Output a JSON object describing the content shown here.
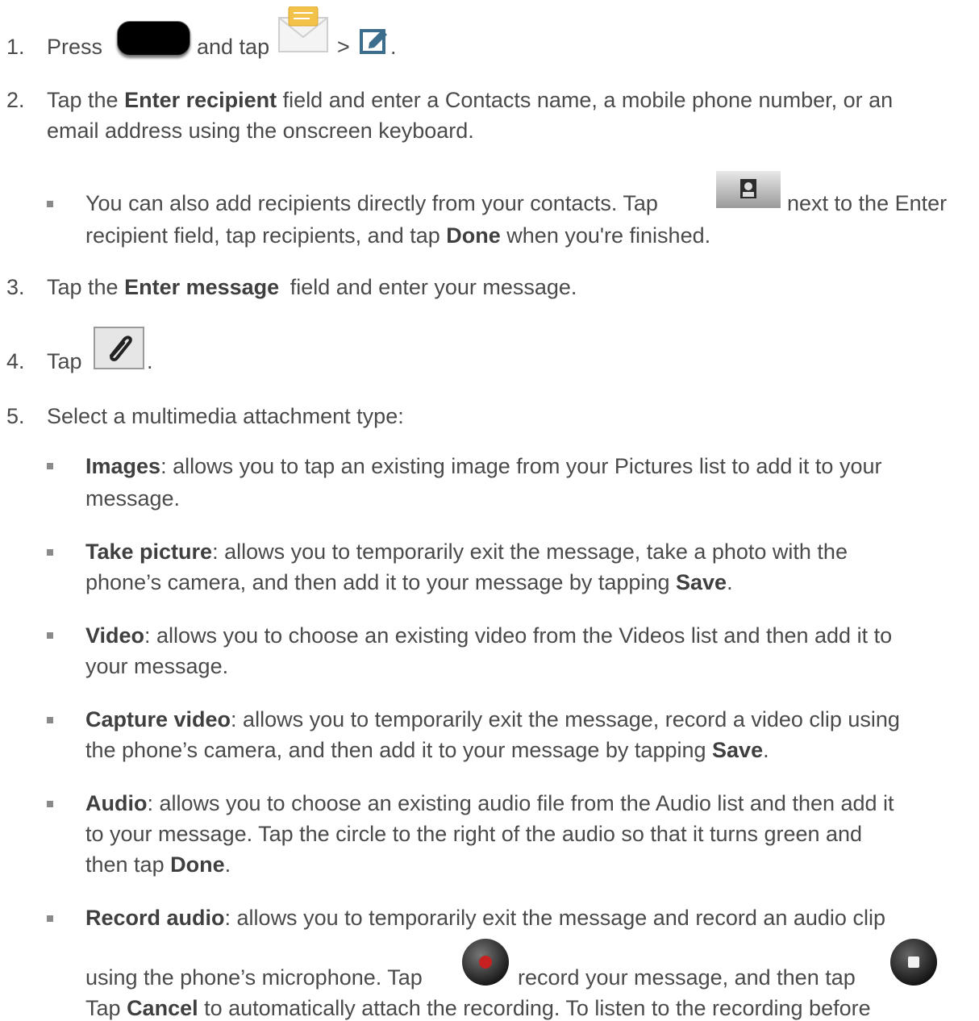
{
  "steps": {
    "s1": {
      "num": "1.",
      "press": "Press",
      "and_tap": "and tap",
      "gt": ">",
      "period": "."
    },
    "s2": {
      "num": "2.",
      "tap_the": "Tap the",
      "field_bold": "Enter recipient",
      "rest1": "field and enter a Contacts name, a mobile phone number, or an",
      "line2": "email address using the onscreen keyboard."
    },
    "s2b": {
      "text1": "You can also add recipients directly from your contacts. Tap",
      "text2": "next to the Enter",
      "line2a": "recipient field, tap recipients, and tap",
      "done": "Done",
      "line2b": "when you're finished."
    },
    "s3": {
      "num": "3.",
      "tap_the": "Tap the",
      "field_bold": "Enter message",
      "rest": "field and enter your message."
    },
    "s4": {
      "num": "4.",
      "tap": "Tap",
      "period": "."
    },
    "s5": {
      "num": "5.",
      "text": "Select a multimedia attachment type:"
    }
  },
  "options": {
    "images": {
      "label": "Images",
      "line1": ": allows you to tap an existing image from your Pictures list to add it to your",
      "line2": "message."
    },
    "take_picture": {
      "label": "Take picture",
      "line1": ": allows you to temporarily exit the message, take a photo with the",
      "line2a": "phone’s camera, and then add it to your message by tapping",
      "save": "Save",
      "period": "."
    },
    "video": {
      "label": "Video",
      "line1": ": allows you to choose an existing video from the Videos list and then add it to",
      "line2": "your message."
    },
    "capture_video": {
      "label": "Capture video",
      "line1": ": allows you to temporarily exit the message, record a video clip using",
      "line2a": "the phone’s camera, and then add it to your message by tapping",
      "save": "Save",
      "period": "."
    },
    "audio": {
      "label": "Audio",
      "line1": ": allows you to choose an existing audio file from the Audio list and then add it",
      "line2": "to your message. Tap the circle to the right of the audio so that it turns green and",
      "line3a": "then tap",
      "done": "Done",
      "period": "."
    },
    "record_audio": {
      "label": "Record audio",
      "line1": ": allows you to temporarily exit the message and record an audio clip",
      "line2a": "using the phone’s microphone. Tap",
      "line2b": "record your message, and then tap",
      "line3a": "Tap",
      "cancel": "Cancel",
      "line3b": "to automatically attach the recording. To listen to the recording before"
    }
  },
  "icons": [
    "home-button-icon",
    "messaging-icon",
    "compose-icon",
    "contacts-icon",
    "attach-paperclip-icon",
    "record-icon",
    "stop-icon"
  ]
}
